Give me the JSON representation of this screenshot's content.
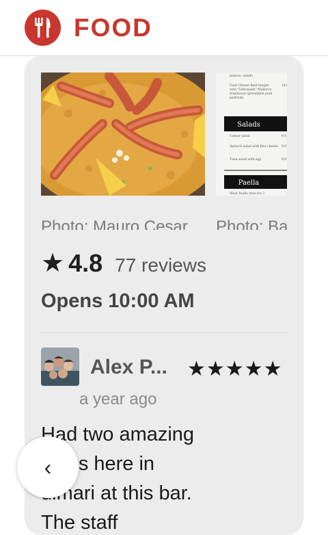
{
  "header": {
    "title": "FOOD",
    "brand_color": "#c8372d",
    "logo_icon": "fork-knife-icon"
  },
  "photos": [
    {
      "credit": "Photo: Mauro Cesar",
      "subject": "paella"
    },
    {
      "credit": "Photo: Ba",
      "subject": "menu"
    }
  ],
  "menu_photo": {
    "section1": "Salads",
    "section2": "Paella",
    "line1": "Goat Cheese Beef burger",
    "line2": "Caesar salad",
    "line3": "Spinach salad with feta cheese",
    "line4": "Tuna salad with egg",
    "line5": "Meat Paella (min for 2"
  },
  "rating": {
    "star_icon": "star-icon",
    "value": "4.8",
    "reviews": "77 reviews",
    "stars": 4.8
  },
  "hours": {
    "text": "Opens 10:00 AM"
  },
  "review": {
    "author": "Alex P...",
    "stars_text": "★★★★★",
    "rating": 5,
    "time": "a year ago",
    "text_line1": "Had two amazing",
    "text_line2": "nings here in",
    "text_line3": "uimari at this bar.",
    "text_line4": "The staff"
  },
  "nav": {
    "back_label": "‹",
    "back_icon": "chevron-left-icon"
  }
}
